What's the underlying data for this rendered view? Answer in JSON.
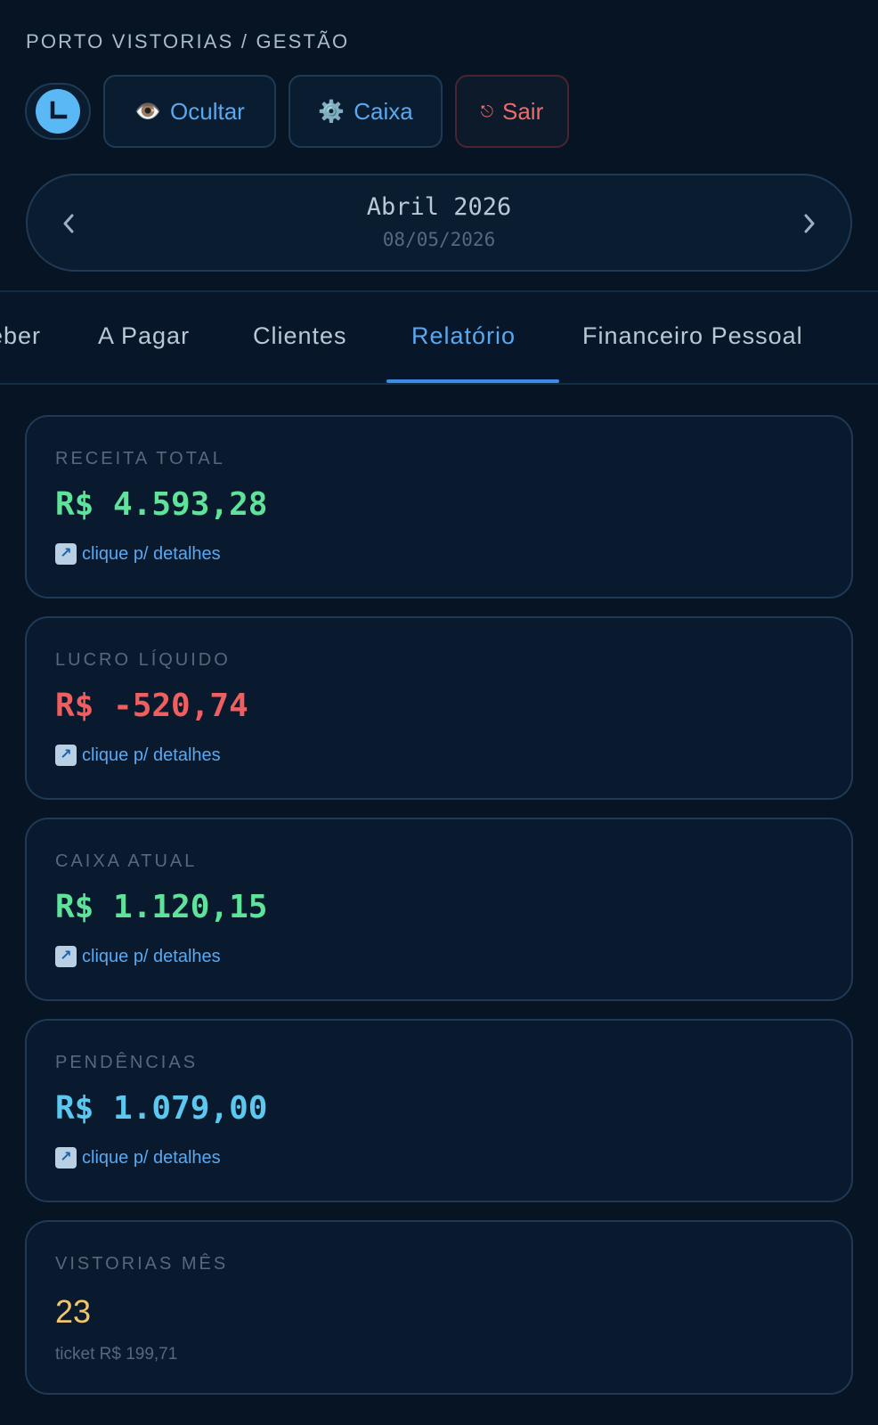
{
  "header": {
    "brand": "PORTO VISTORIAS / GESTÃO",
    "avatar_letter": "L"
  },
  "toolbar": {
    "hide_icon": "👁️",
    "hide_label": "Ocultar",
    "cash_icon": "⚙️",
    "cash_label": "Caixa",
    "exit_icon": "⎋",
    "exit_label": "Sair"
  },
  "month_nav": {
    "prev_icon": "‹",
    "next_icon": "›",
    "title": "Abril 2026",
    "date": "08/05/2026"
  },
  "tabs": [
    {
      "label": "eber"
    },
    {
      "label": "A Pagar"
    },
    {
      "label": "Clientes"
    },
    {
      "label": "Relatório",
      "active": true
    },
    {
      "label": "Financeiro Pessoal"
    }
  ],
  "cards": [
    {
      "label": "RECEITA TOTAL",
      "value": "R$ 4.593,28",
      "color": "#5fe39a",
      "link": "clique p/ detalhes"
    },
    {
      "label": "LUCRO LÍQUIDO",
      "value": "R$ -520,74",
      "color": "#ef5f5f",
      "link": "clique p/ detalhes"
    },
    {
      "label": "CAIXA ATUAL",
      "value": "R$ 1.120,15",
      "color": "#5fe39a",
      "link": "clique p/ detalhes"
    },
    {
      "label": "PENDÊNCIAS",
      "value": "R$ 1.079,00",
      "color": "#5cc8f0",
      "link": "clique p/ detalhes"
    },
    {
      "label": "VISTORIAS MÊS",
      "value": "23",
      "color": "#f2c46b",
      "sub": "ticket R$ 199,71"
    }
  ],
  "link_icon": "↗"
}
